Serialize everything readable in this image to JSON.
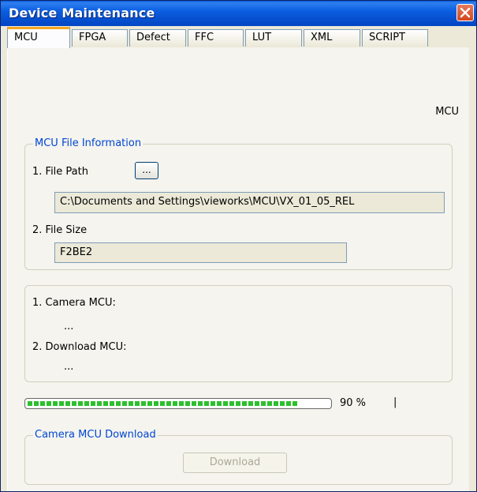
{
  "window": {
    "title": "Device Maintenance"
  },
  "tabs": [
    {
      "label": "MCU",
      "active": true
    },
    {
      "label": "FPGA"
    },
    {
      "label": "Defect"
    },
    {
      "label": "FFC"
    },
    {
      "label": "LUT"
    },
    {
      "label": "XML"
    },
    {
      "label": "SCRIPT"
    }
  ],
  "panel": {
    "mode_label": "MCU"
  },
  "file_info": {
    "title": "MCU File Information",
    "path_label": "1. File Path",
    "browse_label": "...",
    "path_value": "C:\\Documents and Settings\\vieworks\\MCU\\VX_01_05_REL",
    "size_label": "2. File Size",
    "size_value": "F2BE2"
  },
  "versions": {
    "camera_label": "1. Camera MCU:",
    "camera_value": "...",
    "download_label": "2. Download MCU:",
    "download_value": "..."
  },
  "progress": {
    "value": 0.9,
    "text": "90 %",
    "cursor": "|"
  },
  "download": {
    "title": "Camera MCU Download",
    "button_label": "Download"
  },
  "colors": {
    "titlebar": "#0b5fe0",
    "group_title": "#0046d5",
    "progress_fill": "#2dbf2d",
    "active_tab_accent": "#f5a623"
  }
}
